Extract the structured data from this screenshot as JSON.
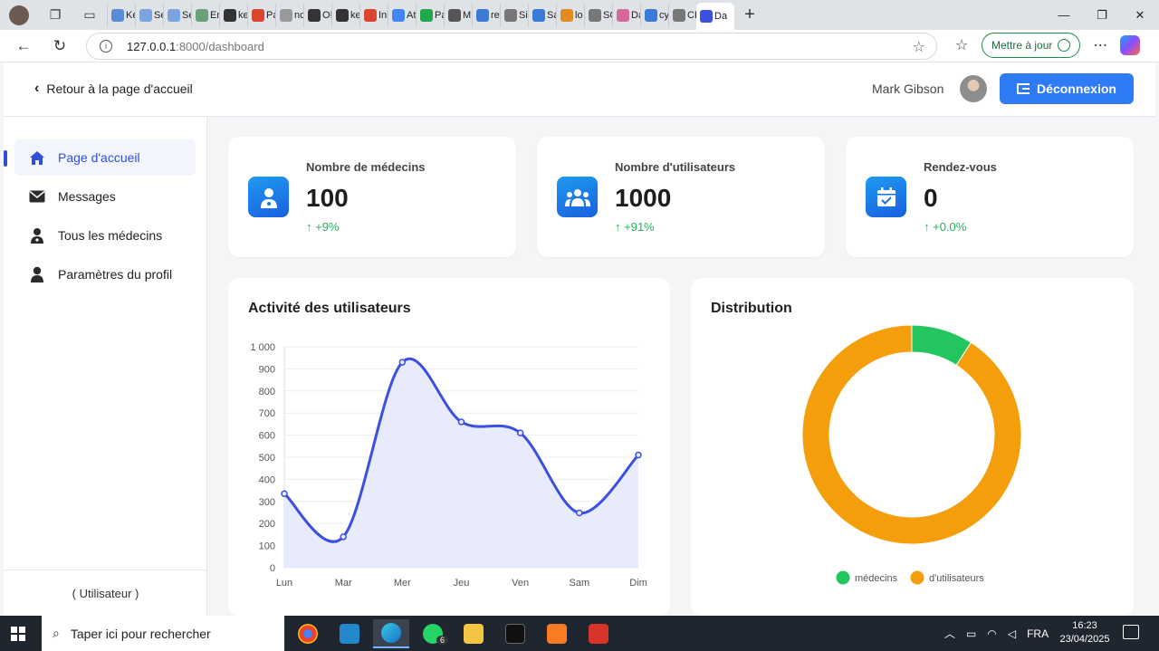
{
  "browser": {
    "tab_labels": [
      "Ke",
      "Se",
      "Se",
      "En",
      "ke",
      "Pa",
      "nc",
      "O!",
      "ke",
      "Ini",
      "At",
      "Pa",
      "M",
      "re",
      "Sir",
      "Sa",
      "lo",
      "SC",
      "Da",
      "cy",
      "CF"
    ],
    "active_tab_label": "Da",
    "url_host": "127.0.0.1",
    "url_path": ":8000/dashboard",
    "update_button": "Mettre à jour"
  },
  "header": {
    "back_label": "Retour à la page d'accueil",
    "user_name": "Mark Gibson",
    "logout_label": "Déconnexion"
  },
  "sidebar": {
    "items": [
      {
        "label": "Page d'accueil",
        "icon": "home-icon"
      },
      {
        "label": "Messages",
        "icon": "envelope-icon"
      },
      {
        "label": "Tous les médecins",
        "icon": "doctor-icon"
      },
      {
        "label": "Paramètres du profil",
        "icon": "user-icon"
      }
    ],
    "footer": "( Utilisateur )"
  },
  "stats": [
    {
      "label": "Nombre de médecins",
      "value": "100",
      "delta": "+9%",
      "icon": "doctor-icon"
    },
    {
      "label": "Nombre d'utilisateurs",
      "value": "1000",
      "delta": "+91%",
      "icon": "users-icon"
    },
    {
      "label": "Rendez-vous",
      "value": "0",
      "delta": "+0.0%",
      "icon": "calendar-check-icon"
    }
  ],
  "activity_card": {
    "title": "Activité des utilisateurs"
  },
  "distribution_card": {
    "title": "Distribution"
  },
  "chart_data": [
    {
      "type": "area",
      "categories": [
        "Lun",
        "Mar",
        "Mer",
        "Jeu",
        "Ven",
        "Sam",
        "Dim"
      ],
      "values": [
        335,
        140,
        930,
        660,
        610,
        248,
        510
      ],
      "ylim": [
        0,
        1000
      ],
      "yticks": [
        "0",
        "100",
        "200",
        "300",
        "400",
        "500",
        "600",
        "700",
        "800",
        "900",
        "1 000"
      ],
      "grid": true,
      "colors": {
        "line": "#3b4fe0",
        "fill": "#e8ebfc"
      }
    },
    {
      "type": "pie",
      "donut": true,
      "labels": [
        "médecins",
        "d'utilisateurs"
      ],
      "values": [
        100,
        1000
      ],
      "colors": [
        "#22c55e",
        "#f59e0b"
      ],
      "legend": "bottom"
    }
  ],
  "taskbar": {
    "search_placeholder": "Taper ici pour rechercher",
    "whatsapp_badge": "6",
    "language": "FRA",
    "time": "16:23",
    "date": "23/04/2025"
  }
}
